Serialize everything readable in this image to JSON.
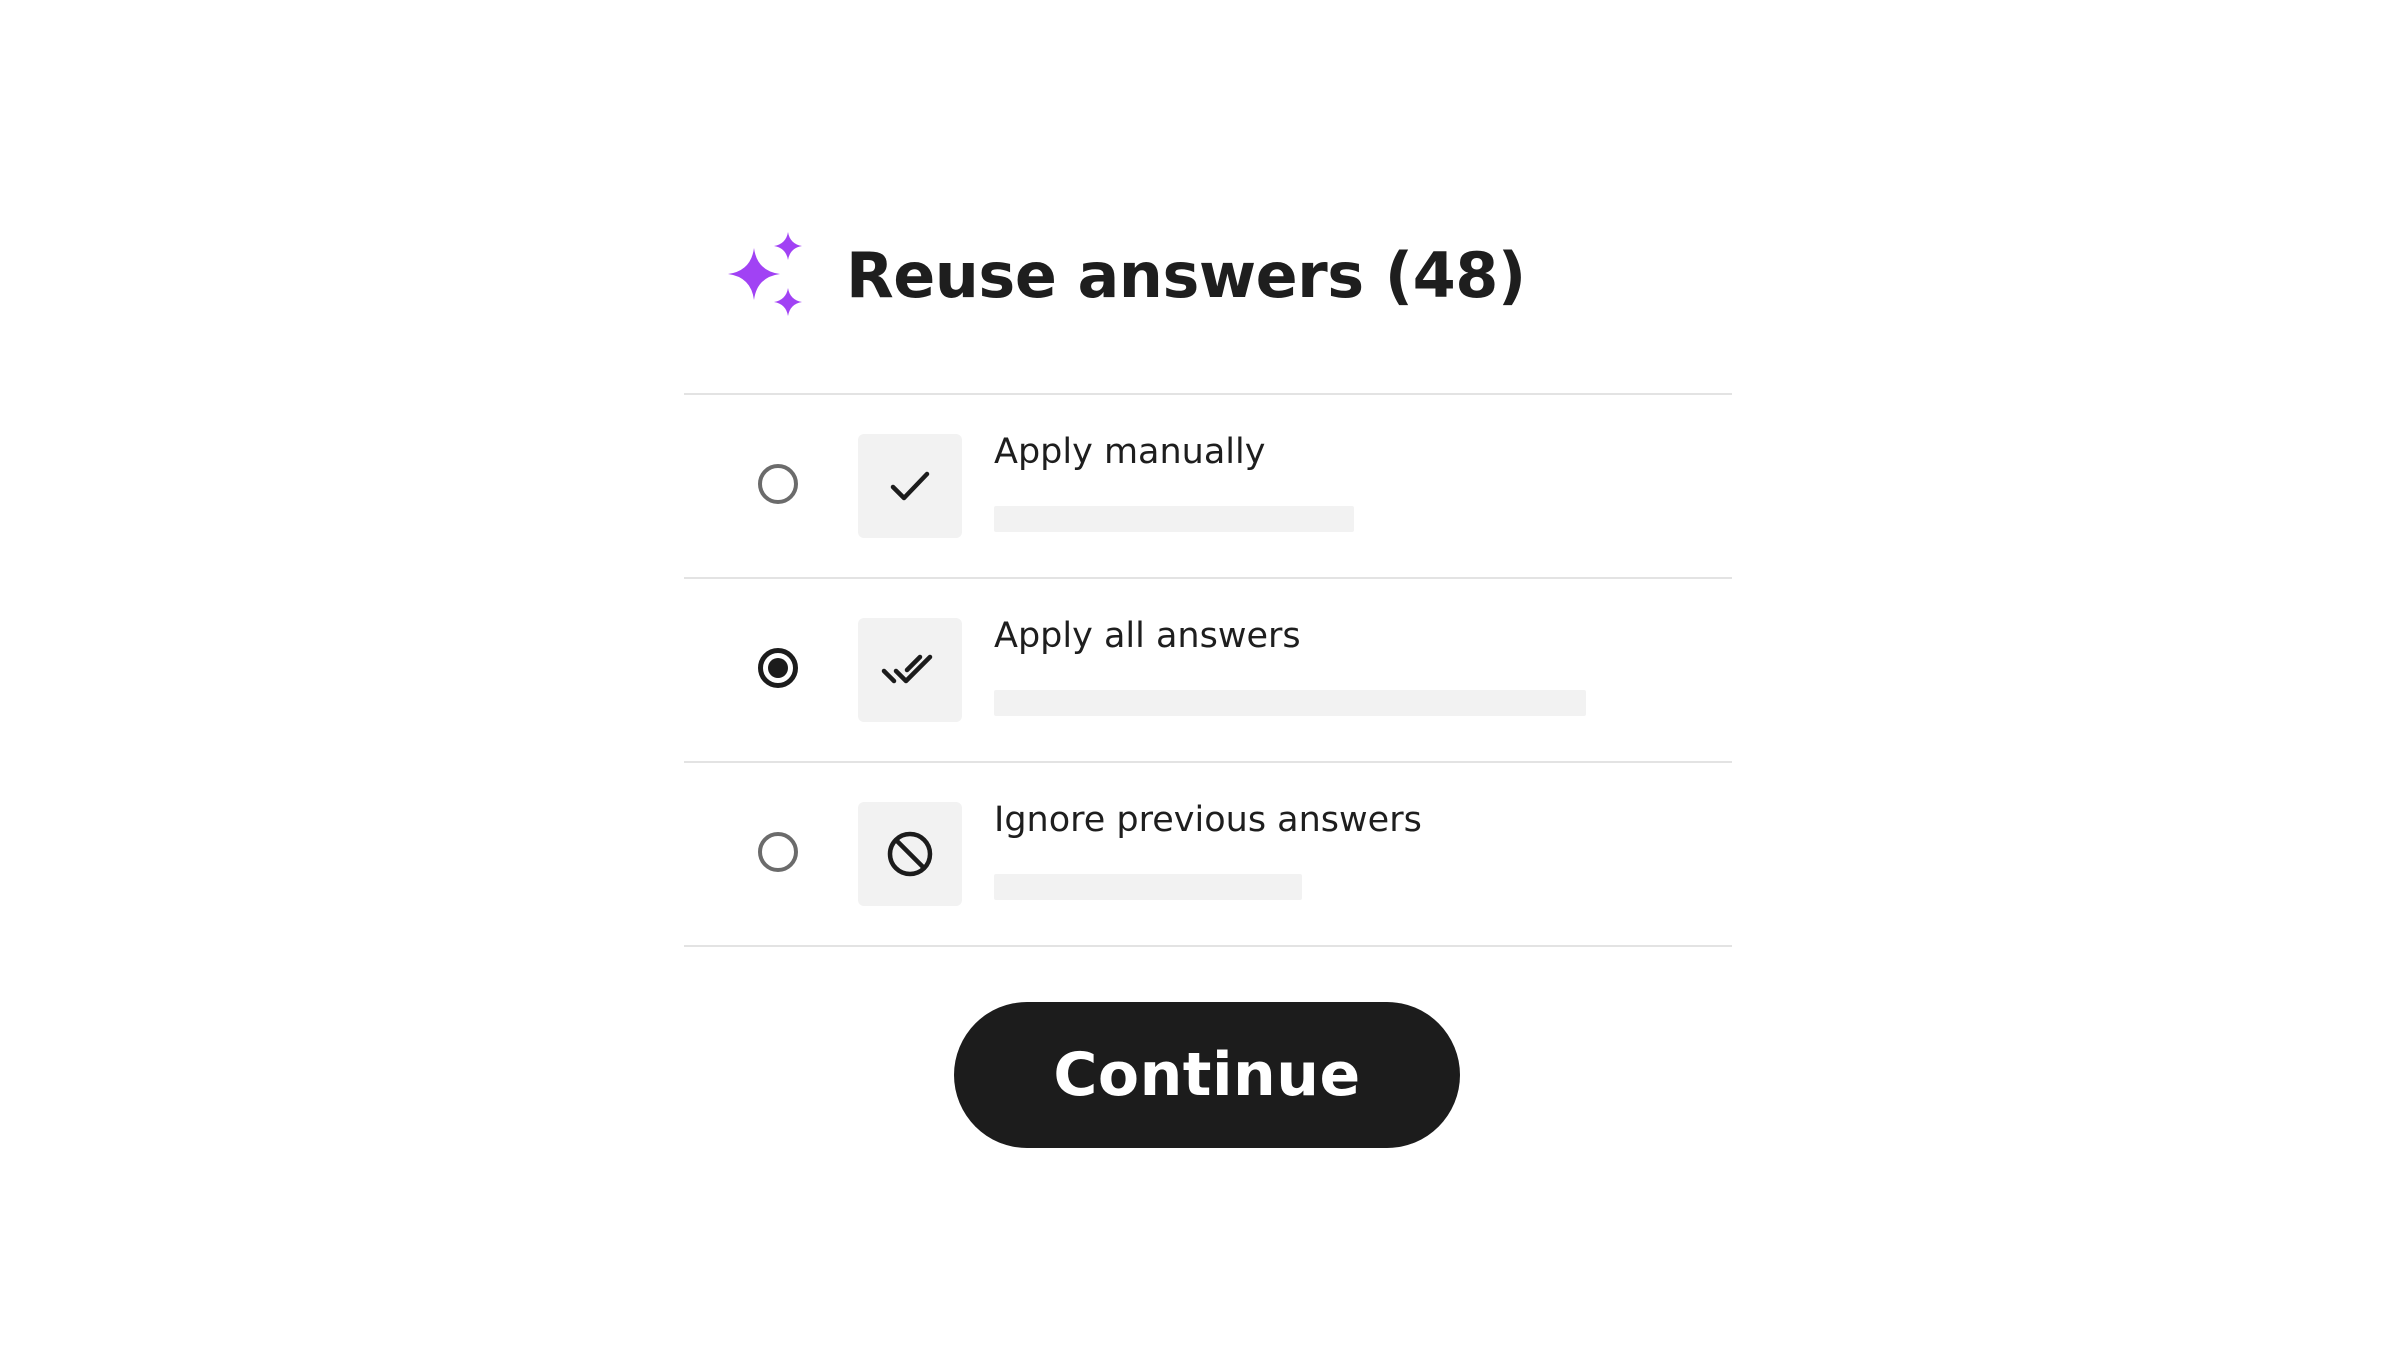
{
  "header": {
    "icon": "sparkle-icon",
    "title": "Reuse answers (48)"
  },
  "options": [
    {
      "label": "Apply manually",
      "icon": "check-icon",
      "selected": false,
      "description": ""
    },
    {
      "label": "Apply all answers",
      "icon": "double-check-icon",
      "selected": true,
      "description": ""
    },
    {
      "label": "Ignore previous answers",
      "icon": "block-icon",
      "selected": false,
      "description": ""
    }
  ],
  "footer": {
    "continue_label": "Continue"
  },
  "colors": {
    "accent": "#a142f4",
    "button_background": "#1c1c1c",
    "button_text": "#ffffff",
    "icon_tile": "#f2f2f2",
    "divider": "#e3e3e3"
  }
}
